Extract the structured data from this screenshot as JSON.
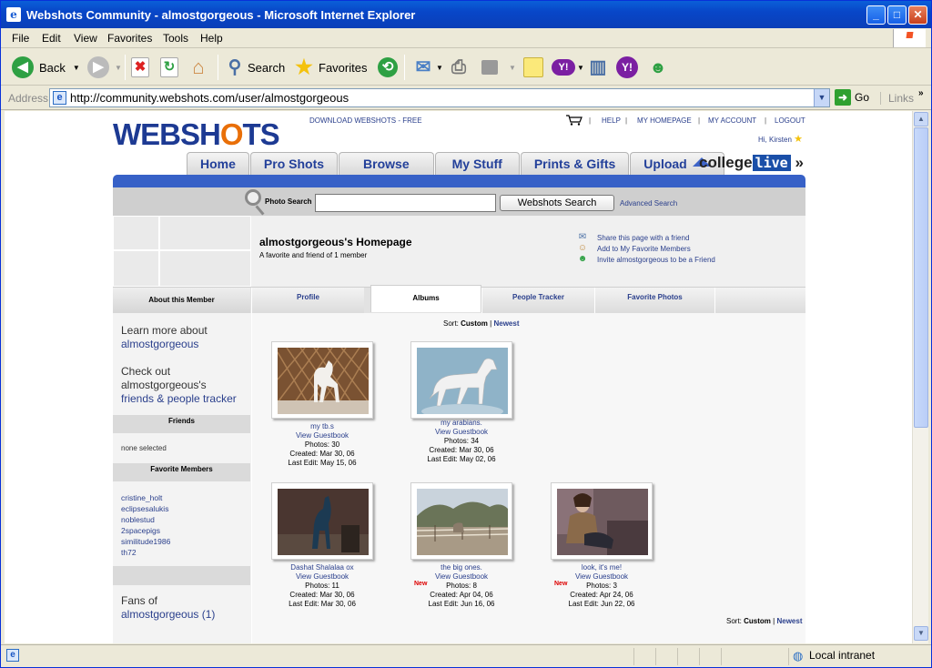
{
  "window": {
    "title": "Webshots Community - almostgorgeous - Microsoft Internet Explorer",
    "controls": [
      "minimize",
      "maximize",
      "close"
    ]
  },
  "menu": [
    "File",
    "Edit",
    "View",
    "Favorites",
    "Tools",
    "Help"
  ],
  "toolbar": {
    "back": "Back",
    "search": "Search",
    "favorites": "Favorites"
  },
  "address": {
    "label": "Address",
    "url": "http://community.webshots.com/user/almostgorgeous",
    "go": "Go",
    "links": "Links"
  },
  "status": {
    "zone": "Local intranet"
  },
  "site": {
    "logo": "WEBSHOTS",
    "download": "DOWNLOAD WEBSHOTS - FREE",
    "toplinks": [
      "HELP",
      "MY HOMEPAGE",
      "MY ACCOUNT",
      "LOGOUT"
    ],
    "greeting": "Hi, Kirsten",
    "nav": [
      "Home",
      "Pro Shots",
      "Browse",
      "My Stuff",
      "Prints & Gifts",
      "Upload"
    ],
    "college": "college",
    "college_live": "live",
    "college_arrow": "»",
    "search_label": "Photo Search",
    "search_value": "",
    "search_button": "Webshots Search",
    "advanced": "Advanced Search"
  },
  "profile": {
    "title": "almostgorgeous's Homepage",
    "subtitle": "A favorite and friend of 1 member",
    "actions": [
      {
        "icon": "envelope-icon",
        "label": "Share this page with a friend"
      },
      {
        "icon": "person-add-icon",
        "label": "Add to My Favorite Members"
      },
      {
        "icon": "person-invite-icon",
        "label": "Invite almostgorgeous to be a Friend"
      }
    ]
  },
  "tabs": {
    "about": "About this Member",
    "items": [
      "Profile",
      "Albums",
      "People Tracker",
      "Favorite Photos"
    ],
    "active": "Albums"
  },
  "sidebar": {
    "learn_prefix": "Learn more about",
    "learn_link": "almostgorgeous",
    "check_prefix": "Check out",
    "check_name": "almostgorgeous's",
    "check_link": "friends & people tracker",
    "friends_head": "Friends",
    "friends_text": "none selected",
    "favorites_head": "Favorite Members",
    "favorite_members": [
      "cristine_holt",
      "eclipsesalukis",
      "noblestud",
      "2spacepigs",
      "similitude1986",
      "th72"
    ],
    "fans_prefix": "Fans of",
    "fans_link": "almostgorgeous (1)"
  },
  "sort": {
    "label": "Sort:",
    "custom": "Custom",
    "sep": "|",
    "newest": "Newest"
  },
  "albums": [
    {
      "title": "my tb.s",
      "guestbook": "View Guestbook",
      "photos": "Photos: 30",
      "created": "Created: Mar 30, 06",
      "edit": "Last Edit: May 15, 06",
      "new": ""
    },
    {
      "title": "my arabians.",
      "guestbook": "View Guestbook",
      "photos": "Photos: 34",
      "created": "Created: Mar 30, 06",
      "edit": "Last Edit: May 02, 06",
      "new": ""
    },
    {
      "title": "Dashat Shalalaa ox",
      "guestbook": "View Guestbook",
      "photos": "Photos: 11",
      "created": "Created: Mar 30, 06",
      "edit": "Last Edit: Mar 30, 06",
      "new": ""
    },
    {
      "title": "the big ones.",
      "guestbook": "View Guestbook",
      "photos": "Photos: 8",
      "created": "Created: Apr 04, 06",
      "edit": "Last Edit: Jun 16, 06",
      "new": "New"
    },
    {
      "title": "look, it's me!",
      "guestbook": "View Guestbook",
      "photos": "Photos: 3",
      "created": "Created: Apr 24, 06",
      "edit": "Last Edit: Jun 22, 06",
      "new": "New"
    }
  ]
}
